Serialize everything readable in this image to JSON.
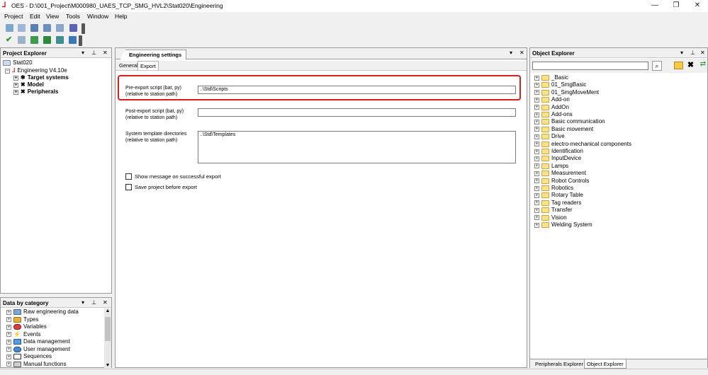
{
  "window": {
    "title": "OES - D:\\001_Project\\M­000980_UAES_TCP_SMG_HVL2\\Stat020\\Engineering"
  },
  "menu": [
    "Project",
    "Edit",
    "View",
    "Tools",
    "Window",
    "Help"
  ],
  "project_explorer": {
    "title": "Project Explorer",
    "tree": [
      {
        "label": "Stat020",
        "level": 0
      },
      {
        "label": "Engineering V4.10e",
        "level": 1
      },
      {
        "label": "Target systems",
        "level": 2
      },
      {
        "label": "Model",
        "level": 2
      },
      {
        "label": "Peripherals",
        "level": 2
      }
    ]
  },
  "data_by_category": {
    "title": "Data by category",
    "items": [
      "Raw engineering data",
      "Types",
      "Variables",
      "Events",
      "Data management",
      "User management",
      "Sequences",
      "Manual functions"
    ]
  },
  "center": {
    "doc_tab": "Engineering settings",
    "tabs": [
      "General",
      "Export"
    ],
    "pre_export": {
      "label1": "Pre-export script (bat, py)",
      "label2": "(relative to station path)",
      "value": "..\\Std\\Scripts"
    },
    "post_export": {
      "label1": "Post-export script (bat, py)",
      "label2": "(relative to station path)",
      "value": ""
    },
    "template_dirs": {
      "label1": "System template directories",
      "label2": "(relative to station path)",
      "value": "..\\Std\\Templates"
    },
    "checkboxes": [
      "Show message on successful export",
      "Save project before export"
    ]
  },
  "object_explorer": {
    "title": "Object Explorer",
    "items": [
      "_Basic",
      "01_SmgBasic",
      "01_SmgMoveMent",
      "Add-on",
      "AddOn",
      "Add-ons",
      "Basic communication",
      "Basic movement",
      "Drive",
      "electro-mechanical components",
      "Identification",
      "InputDevice",
      "Lamps",
      "Measurement",
      "Robot Controls",
      "Robotics",
      "Rotary Table",
      "Tag readers",
      "Transfer",
      "Vision",
      "Welding System"
    ],
    "bottom_tabs": [
      "Peripherals Explorer",
      "Object Explorer"
    ]
  },
  "colors": {
    "highlight": "#d42020",
    "tab_active": "#ffffff"
  }
}
